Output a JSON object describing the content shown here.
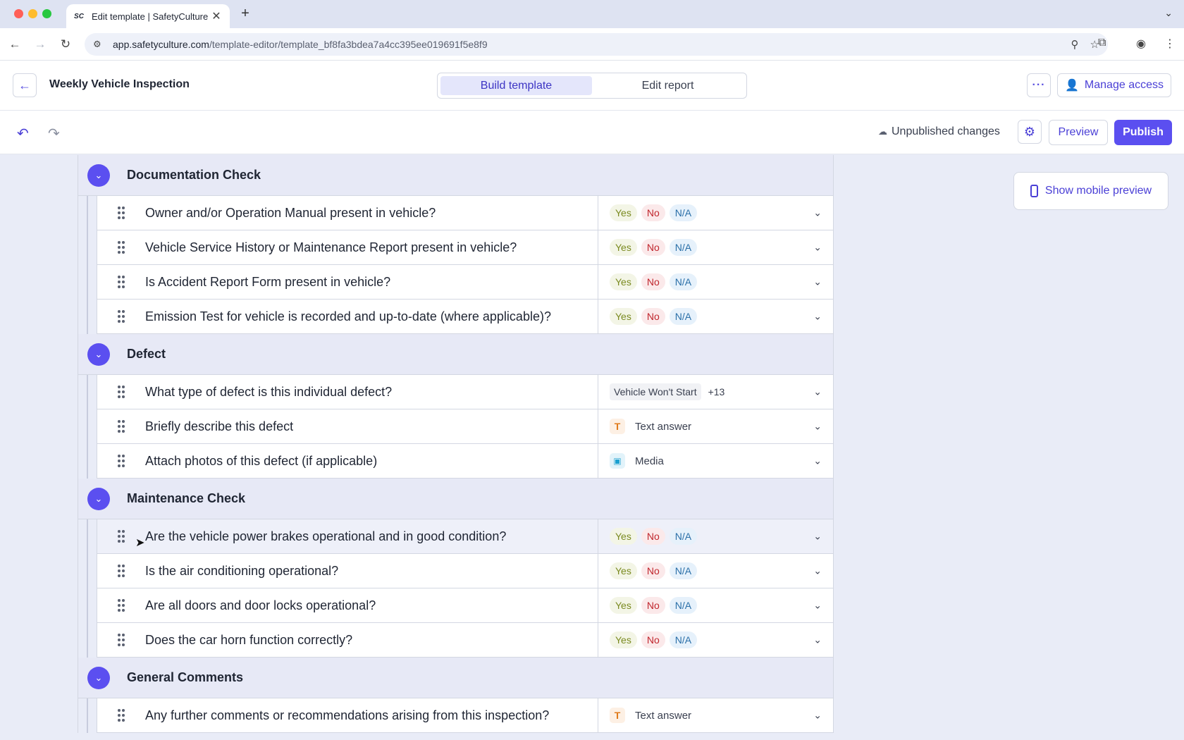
{
  "browser": {
    "tab_title": "Edit template | SafetyCulture",
    "tab_favicon": "SC",
    "url_host": "app.safetyculture.com",
    "url_path": "/template-editor/template_bf8fa3bdea7a4cc395ee019691f5e8f9"
  },
  "header": {
    "title": "Weekly Vehicle Inspection",
    "tabs": [
      "Build template",
      "Edit report"
    ],
    "active_tab": "Build template",
    "manage_access": "Manage access"
  },
  "toolbar": {
    "status": "Unpublished changes",
    "preview": "Preview",
    "publish": "Publish"
  },
  "mobile_preview": "Show mobile preview",
  "colors": {
    "accent": "#5b4ff0",
    "yes": "#7a8a20",
    "no": "#c0262d",
    "na": "#2a6fa8"
  },
  "responses": {
    "yes": "Yes",
    "no": "No",
    "na": "N/A"
  },
  "sections": [
    {
      "title": "Documentation Check",
      "questions": [
        {
          "text": "Owner and/or Operation Manual present in vehicle?",
          "type": "yes_no_na"
        },
        {
          "text": "Vehicle Service History or Maintenance Report present in vehicle?",
          "type": "yes_no_na"
        },
        {
          "text": "Is Accident Report Form present in vehicle?",
          "type": "yes_no_na"
        },
        {
          "text": "Emission Test for vehicle is recorded and up-to-date (where applicable)?",
          "type": "yes_no_na"
        }
      ]
    },
    {
      "title": "Defect",
      "questions": [
        {
          "text": "What type of defect is this individual defect?",
          "type": "multiple_choice",
          "option": "Vehicle Won't Start",
          "more": "+13"
        },
        {
          "text": "Briefly describe this defect",
          "type": "text",
          "label": "Text answer"
        },
        {
          "text": "Attach photos of this defect (if applicable)",
          "type": "media",
          "label": "Media"
        }
      ]
    },
    {
      "title": "Maintenance Check",
      "questions": [
        {
          "text": "Are the vehicle power brakes operational and in good condition?",
          "type": "yes_no_na"
        },
        {
          "text": "Is the air conditioning operational?",
          "type": "yes_no_na"
        },
        {
          "text": "Are all doors and door locks operational?",
          "type": "yes_no_na"
        },
        {
          "text": "Does the car horn function correctly?",
          "type": "yes_no_na"
        }
      ]
    },
    {
      "title": "General Comments",
      "questions": [
        {
          "text": "Any further comments or recommendations arising from this inspection?",
          "type": "text",
          "label": "Text answer"
        }
      ]
    }
  ]
}
